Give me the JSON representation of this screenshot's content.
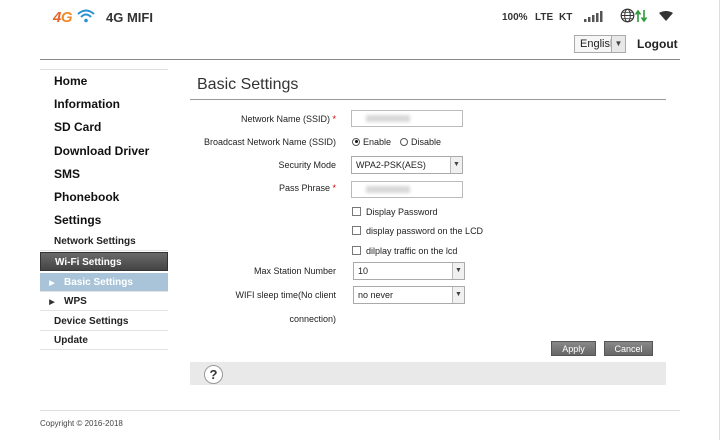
{
  "header": {
    "logo_4": "4",
    "logo_g": "G",
    "brand": "4G MIFI",
    "battery": "100%",
    "network_type": "LTE",
    "carrier": "KT",
    "language": "English",
    "logout": "Logout"
  },
  "sidebar": {
    "items": [
      {
        "label": "Home"
      },
      {
        "label": "Information"
      },
      {
        "label": "SD Card"
      },
      {
        "label": "Download Driver"
      },
      {
        "label": "SMS"
      },
      {
        "label": "Phonebook"
      },
      {
        "label": "Settings"
      }
    ],
    "sub_items": [
      {
        "label": "Network Settings"
      },
      {
        "label": "Wi-Fi Settings"
      },
      {
        "label": "Basic Settings"
      },
      {
        "label": "WPS"
      },
      {
        "label": "Device Settings"
      },
      {
        "label": "Update"
      }
    ]
  },
  "main": {
    "title": "Basic Settings",
    "ssid_label": "Network Name (SSID)",
    "broadcast_label": "Broadcast Network Name (SSID)",
    "broadcast_enable": "Enable",
    "broadcast_disable": "Disable",
    "security_label": "Security Mode",
    "security_value": "WPA2-PSK(AES)",
    "pass_label": "Pass Phrase",
    "required_mark": "*",
    "display_password": "Display Password",
    "display_password_lcd": "display password on the LCD",
    "display_traffic_lcd": "dilplay traffic on the lcd",
    "max_station_label": "Max Station Number",
    "max_station_value": "10",
    "sleep_label_1": "WIFI sleep time(No client",
    "sleep_label_2": "connection)",
    "sleep_value": "no never",
    "apply": "Apply",
    "cancel": "Cancel",
    "help": "?"
  },
  "footer": {
    "copyright": "Copyright © 2016-2018"
  },
  "colors": {
    "accent_orange": "#e7652a",
    "wifi_blue": "#2a8fd0",
    "sidebar_selected": "#a9c4d8",
    "arrows_green": "#2c9a3a"
  }
}
